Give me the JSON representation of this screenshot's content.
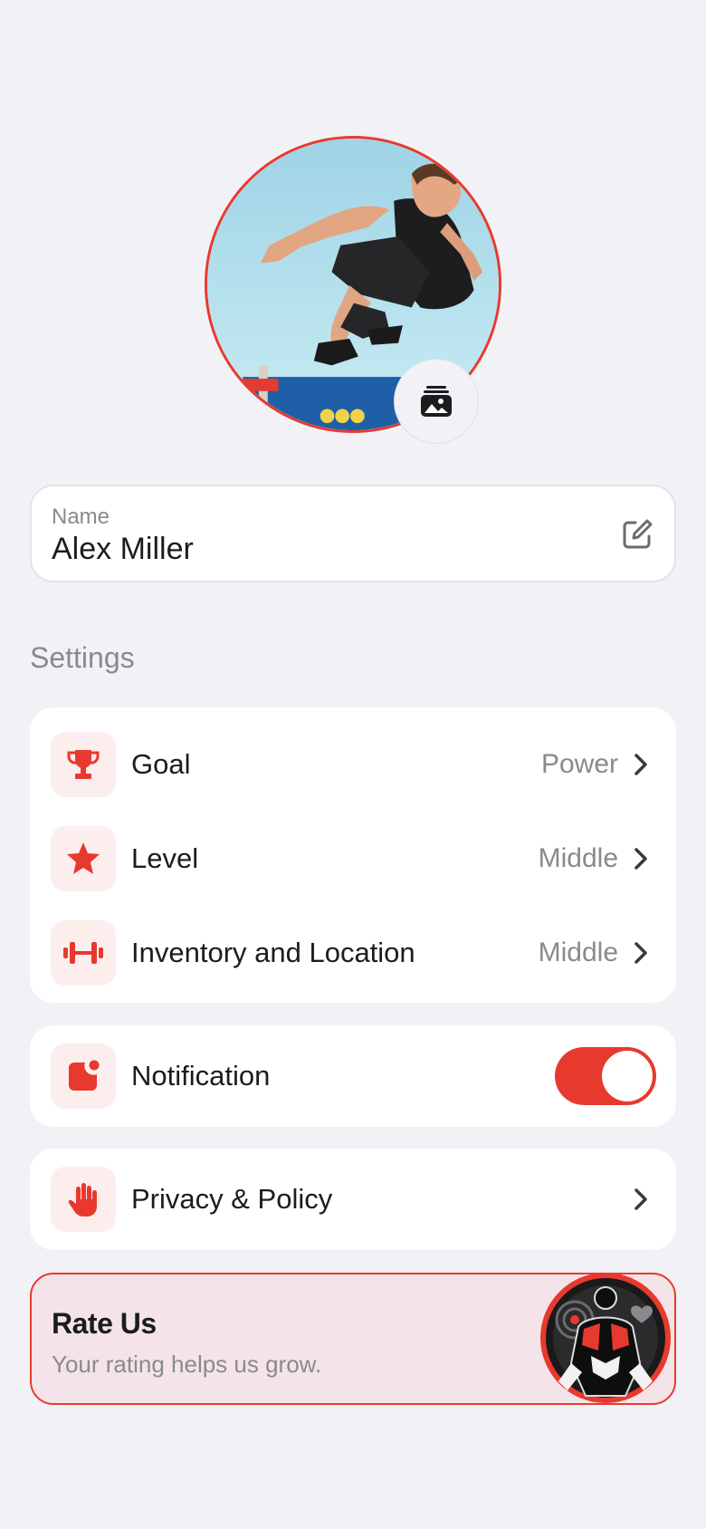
{
  "profile": {
    "photo_alt": "Profile photo",
    "change_photo_icon": "photo-stack-icon"
  },
  "name_field": {
    "label": "Name",
    "value": "Alex Miller",
    "edit_icon": "edit-icon"
  },
  "settings": {
    "title": "Settings",
    "items": [
      {
        "label": "Goal",
        "value": "Power",
        "icon": "trophy-icon"
      },
      {
        "label": "Level",
        "value": "Middle",
        "icon": "star-icon"
      },
      {
        "label": "Inventory and Location",
        "value": "Middle",
        "icon": "dumbbell-icon"
      }
    ]
  },
  "notification": {
    "label": "Notification",
    "icon": "notification-badge-icon",
    "enabled": true
  },
  "privacy": {
    "label": "Privacy & Policy",
    "icon": "hand-icon"
  },
  "rate": {
    "title": "Rate Us",
    "subtitle": "Your rating helps us grow."
  },
  "colors": {
    "accent": "#e8392e",
    "background": "#f2f1f6",
    "card": "#ffffff",
    "secondary_text": "#8a8a8e",
    "icon_tile": "#fdeeee",
    "rate_bg": "#f4e4e9"
  }
}
